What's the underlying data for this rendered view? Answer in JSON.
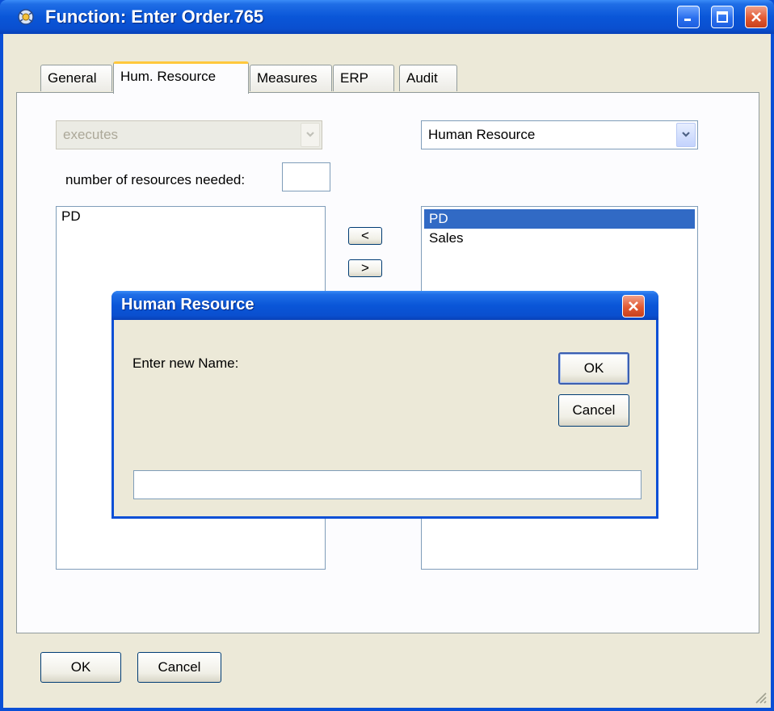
{
  "window": {
    "title": "Function: Enter Order.765"
  },
  "tabs": [
    {
      "label": "General"
    },
    {
      "label": "Hum. Resource"
    },
    {
      "label": "Measures"
    },
    {
      "label": "ERP"
    },
    {
      "label": "Audit"
    }
  ],
  "panel": {
    "relation_combo": {
      "value": "executes"
    },
    "type_combo": {
      "value": "Human Resource"
    },
    "resources_needed_label": "number of resources needed:",
    "resources_needed_value": "",
    "assigned_list": [
      "PD"
    ],
    "available_list": [
      {
        "label": "PD",
        "selected": true
      },
      {
        "label": "Sales",
        "selected": false
      }
    ],
    "move_left_label": "<",
    "move_right_label": ">"
  },
  "dialog": {
    "title": "Human Resource",
    "prompt": "Enter new Name:",
    "ok_label": "OK",
    "cancel_label": "Cancel",
    "name_value": ""
  },
  "footer": {
    "ok_label": "OK",
    "cancel_label": "Cancel"
  },
  "colors": {
    "titlebar": "#0a56d8",
    "selection": "#316ac5",
    "active_tab_accent": "#ffc83c",
    "face": "#ece9d8"
  }
}
